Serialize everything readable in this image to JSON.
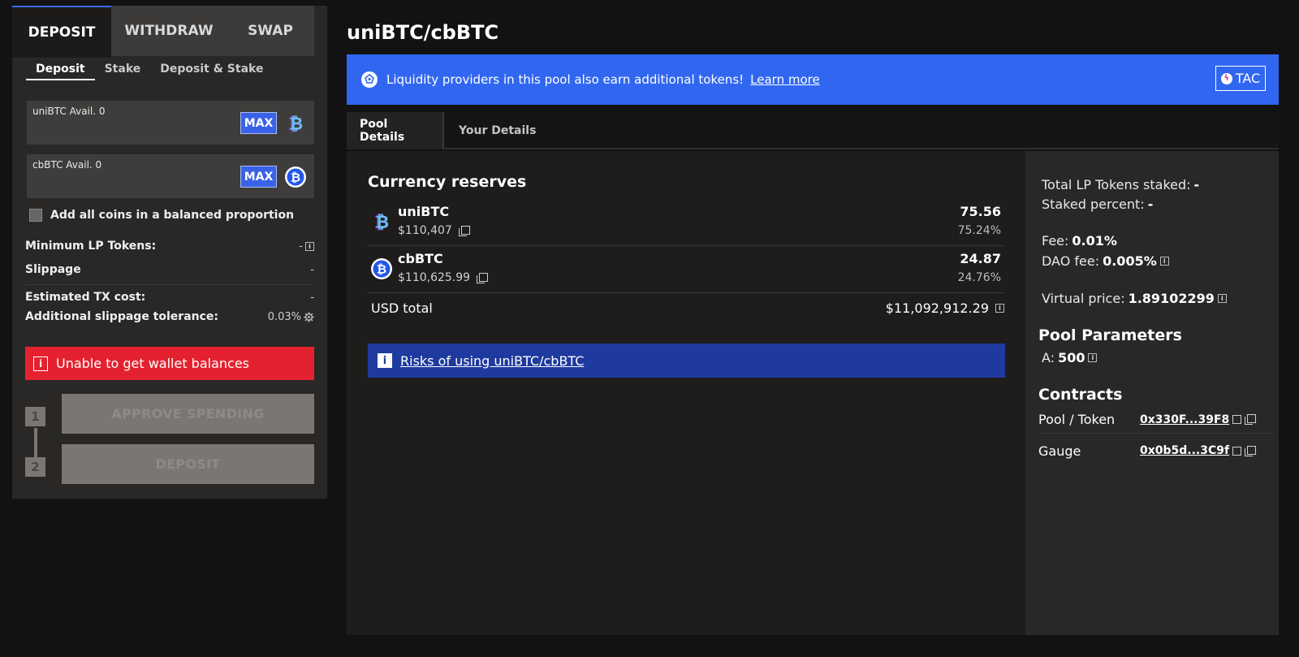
{
  "left": {
    "tabs": [
      {
        "label": "DEPOSIT"
      },
      {
        "label": "WITHDRAW"
      },
      {
        "label": "SWAP"
      }
    ],
    "subtabs": [
      {
        "label": "Deposit"
      },
      {
        "label": "Stake"
      },
      {
        "label": "Deposit & Stake"
      }
    ],
    "inputs": [
      {
        "label": "uniBTC Avail. 0",
        "max_label": "MAX",
        "value": ""
      },
      {
        "label": "cbBTC Avail. 0",
        "max_label": "MAX",
        "value": ""
      }
    ],
    "balanced_label": "Add all coins in a balanced proportion",
    "min_lp": {
      "label": "Minimum LP Tokens:",
      "value": "-"
    },
    "slippage": {
      "label": "Slippage",
      "value": "-"
    },
    "tx_cost": {
      "label": "Estimated TX cost:",
      "value": "-"
    },
    "add_slippage": {
      "label": "Additional slippage tolerance:",
      "value": "0.03%"
    },
    "error": "Unable to get wallet balances",
    "steps": [
      {
        "num": "1",
        "label": "APPROVE SPENDING"
      },
      {
        "num": "2",
        "label": "DEPOSIT"
      }
    ]
  },
  "pool": {
    "title": "uniBTC/cbBTC",
    "banner_text": "Liquidity providers in this pool also earn additional tokens!",
    "banner_link": "Learn more",
    "badge": "TAC",
    "tabs": [
      {
        "label": "Pool Details"
      },
      {
        "label": "Your Details"
      }
    ],
    "reserves_title": "Currency reserves",
    "reserves": [
      {
        "name": "uniBTC",
        "price": "$110,407",
        "amount": "75.56",
        "percent": "75.24%"
      },
      {
        "name": "cbBTC",
        "price": "$110,625.99",
        "amount": "24.87",
        "percent": "24.76%"
      }
    ],
    "usd_total_label": "USD total",
    "usd_total_value": "$11,092,912.29",
    "risk_link": "Risks of using uniBTC/cbBTC"
  },
  "params": {
    "lp_staked_label": "Total LP Tokens staked:",
    "lp_staked_value": "-",
    "staked_pct_label": "Staked percent:",
    "staked_pct_value": "-",
    "fee_label": "Fee:",
    "fee_value": "0.01%",
    "dao_fee_label": "DAO fee:",
    "dao_fee_value": "0.005%",
    "virtual_price_label": "Virtual price:",
    "virtual_price_value": "1.89102299",
    "pool_params_title": "Pool Parameters",
    "a_label": "A:",
    "a_value": "500",
    "contracts_title": "Contracts",
    "contracts": [
      {
        "label": "Pool / Token",
        "address": "0x330F...39F8"
      },
      {
        "label": "Gauge",
        "address": "0x0b5d...3C9f"
      }
    ]
  },
  "colors": {
    "accent_blue": "#3167f0",
    "error_red": "#e4222f",
    "risk_blue": "#1f3a9e"
  }
}
